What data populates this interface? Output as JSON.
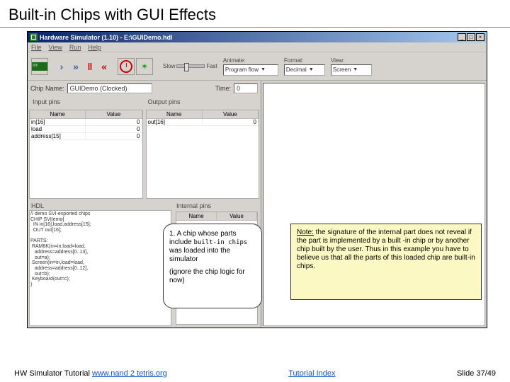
{
  "slide": {
    "title": "Built-in Chips with GUI Effects"
  },
  "window": {
    "title": "Hardware Simulator (1.10) - E:\\GUIDemo.hdl"
  },
  "menus": [
    "File",
    "View",
    "Run",
    "Help"
  ],
  "slider": {
    "left": "Slow",
    "right": "Fast"
  },
  "animate": {
    "label": "Animate:",
    "value": "Program flow"
  },
  "format": {
    "label": "Format:",
    "value": "Decimal"
  },
  "view": {
    "label": "View:",
    "value": "Screen"
  },
  "chipname": {
    "label": "Chip Name:",
    "value": "GUIDemo (Clocked)"
  },
  "time": {
    "label": "Time:",
    "value": "0"
  },
  "inputs": {
    "title": "Input pins",
    "headers": [
      "Name",
      "Value"
    ],
    "rows": [
      {
        "name": "in[16]",
        "value": "0"
      },
      {
        "name": "load",
        "value": "0"
      },
      {
        "name": "address[15]",
        "value": "0"
      }
    ]
  },
  "outputs": {
    "title": "Output pins",
    "headers": [
      "Name",
      "Value"
    ],
    "rows": [
      {
        "name": "out[16]",
        "value": "0"
      }
    ]
  },
  "hdl": {
    "title": "HDL",
    "code": "// demo SVI-exported chips\nCHIP SVIIemo{\n  IN in[16],load,address[15];\n  OUT out[16];\n\nPARTS:\n RAM8K(in=in,load=load,\n   address=address[0..13],\n   out=a);\n Screen(in=in,load=load,\n   address=address[0..12],\n   out=b);\n Keyboard(out=c);\n}"
  },
  "internal": {
    "title": "Internal pins",
    "headers": [
      "Name",
      "Value"
    ],
    "rows": []
  },
  "callout1": {
    "text1": "1. A chip whose parts include ",
    "term": "built-in chips",
    "text2": " was loaded into the simulator",
    "text3": "(ignore the chip logic for now)"
  },
  "callout2": {
    "noteLabel": "Note:",
    "text": " the signature of the internal part does not reveal if the part is implemented by a built -in chip or by another chip built by the user. Thus in this example you have to believe us that all the parts of this loaded chip are built-in chips."
  },
  "footer": {
    "leftText": "HW Simulator Tutorial ",
    "leftLink": "www.nand 2 tetris.org",
    "centerLink": "Tutorial Index",
    "right": "Slide 37/49"
  }
}
